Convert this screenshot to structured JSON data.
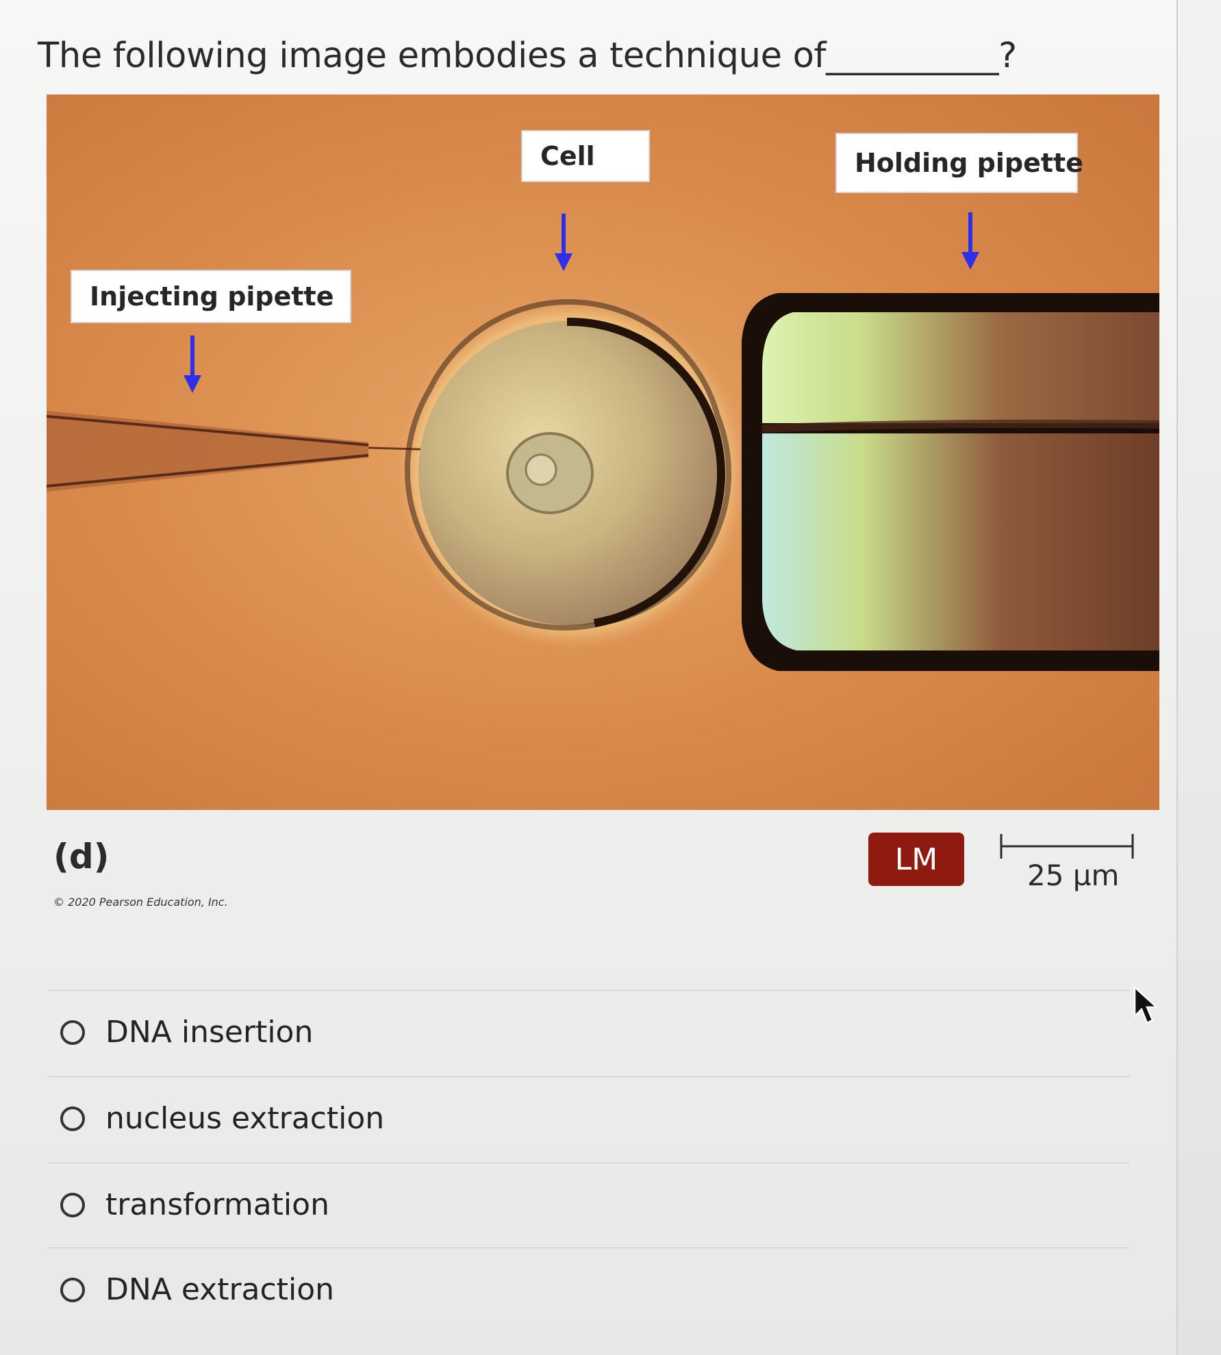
{
  "question": {
    "text": "The following image embodies a technique of__________?"
  },
  "figure": {
    "labels": {
      "injecting_pipette": "Injecting pipette",
      "cell": "Cell",
      "holding_pipette": "Holding pipette"
    },
    "panel_letter": "(d)",
    "copyright": "© 2020 Pearson Education, Inc.",
    "microscopy_badge": "LM",
    "scale_bar_label": "25 µm",
    "arrow_color": "#2f2fe8",
    "badge_color": "#8e1a10"
  },
  "options": [
    {
      "label": "DNA insertion",
      "selected": false
    },
    {
      "label": "nucleus extraction",
      "selected": false
    },
    {
      "label": "transformation",
      "selected": false
    },
    {
      "label": "DNA extraction",
      "selected": false
    }
  ]
}
